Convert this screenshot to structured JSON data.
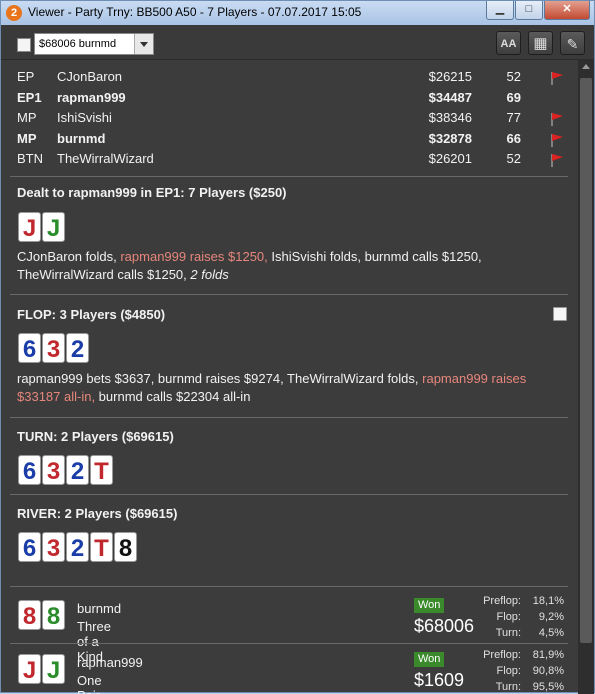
{
  "window": {
    "icon_text": "2",
    "title": "Viewer - Party Trny: BB500 A50 - 7 Players - 07.07.2017 15:05",
    "minimize": "▁",
    "maximize": "□",
    "close": "✕"
  },
  "toolbar": {
    "player_select": "$68006 burnmd",
    "font_button": "AA",
    "grid_button": "▦",
    "edit_button": "✎"
  },
  "players": [
    {
      "pos": "EP",
      "name": "CJonBaron",
      "stack": "$26215",
      "vpip": "52",
      "flag": true,
      "bold": false
    },
    {
      "pos": "EP1",
      "name": "rapman999",
      "stack": "$34487",
      "vpip": "69",
      "flag": false,
      "bold": true
    },
    {
      "pos": "MP",
      "name": "IshiSvishi",
      "stack": "$38346",
      "vpip": "77",
      "flag": true,
      "bold": false
    },
    {
      "pos": "MP",
      "name": "burnmd",
      "stack": "$32878",
      "vpip": "66",
      "flag": true,
      "bold": true
    },
    {
      "pos": "BTN",
      "name": "TheWirralWizard",
      "stack": "$26201",
      "vpip": "52",
      "flag": true,
      "bold": false
    }
  ],
  "preflop": {
    "header": "Dealt to rapman999 in EP1: 7 Players ($250)",
    "cards": [
      {
        "r": "J",
        "c": "#c0282d"
      },
      {
        "r": "J",
        "c": "#2a8c2a"
      }
    ],
    "a1": "CJonBaron folds, ",
    "a2": "rapman999 raises $1250,",
    "a3": " IshiSvishi folds, burnmd calls $1250,",
    "a4": "TheWirralWizard calls $1250, ",
    "a5": "2 folds"
  },
  "flop": {
    "header": "FLOP: 3 Players ($4850)",
    "cards": [
      {
        "r": "6",
        "c": "#1a3da8"
      },
      {
        "r": "3",
        "c": "#c0282d"
      },
      {
        "r": "2",
        "c": "#1a3da8"
      }
    ],
    "a1": "rapman999 bets $3637, burnmd raises $9274, TheWirralWizard folds, ",
    "a2": "rapman999 raises",
    "a3": "$33187 all-in,",
    "a4": " burnmd calls $22304 all-in"
  },
  "turn": {
    "header": "TURN: 2 Players ($69615)",
    "cards": [
      {
        "r": "6",
        "c": "#1a3da8"
      },
      {
        "r": "3",
        "c": "#c0282d"
      },
      {
        "r": "2",
        "c": "#1a3da8"
      },
      {
        "r": "T",
        "c": "#c0282d"
      }
    ]
  },
  "river": {
    "header": "RIVER: 2 Players ($69615)",
    "cards": [
      {
        "r": "6",
        "c": "#1a3da8"
      },
      {
        "r": "3",
        "c": "#c0282d"
      },
      {
        "r": "2",
        "c": "#1a3da8"
      },
      {
        "r": "T",
        "c": "#c0282d"
      },
      {
        "r": "8",
        "c": "#111111"
      }
    ]
  },
  "results": [
    {
      "name": "burnmd",
      "hand": "Three of a Kind",
      "badge": "Won",
      "amount": "$68006",
      "cards": [
        {
          "r": "8",
          "c": "#c0282d"
        },
        {
          "r": "8",
          "c": "#2a8c2a"
        }
      ],
      "stats": [
        {
          "l": "Preflop:",
          "v": "18,1%"
        },
        {
          "l": "Flop:",
          "v": "9,2%"
        },
        {
          "l": "Turn:",
          "v": "4,5%"
        }
      ]
    },
    {
      "name": "rapman999",
      "hand": "One Pair",
      "badge": "Won",
      "amount": "$1609",
      "cards": [
        {
          "r": "J",
          "c": "#c0282d"
        },
        {
          "r": "J",
          "c": "#2a8c2a"
        }
      ],
      "stats": [
        {
          "l": "Preflop:",
          "v": "81,9%"
        },
        {
          "l": "Flop:",
          "v": "90,8%"
        },
        {
          "l": "Turn:",
          "v": "95,5%"
        }
      ]
    }
  ],
  "colors": {
    "highlight": "#e6867c",
    "won_badge": "#3a8a2c",
    "background": "#3c3c3c"
  }
}
